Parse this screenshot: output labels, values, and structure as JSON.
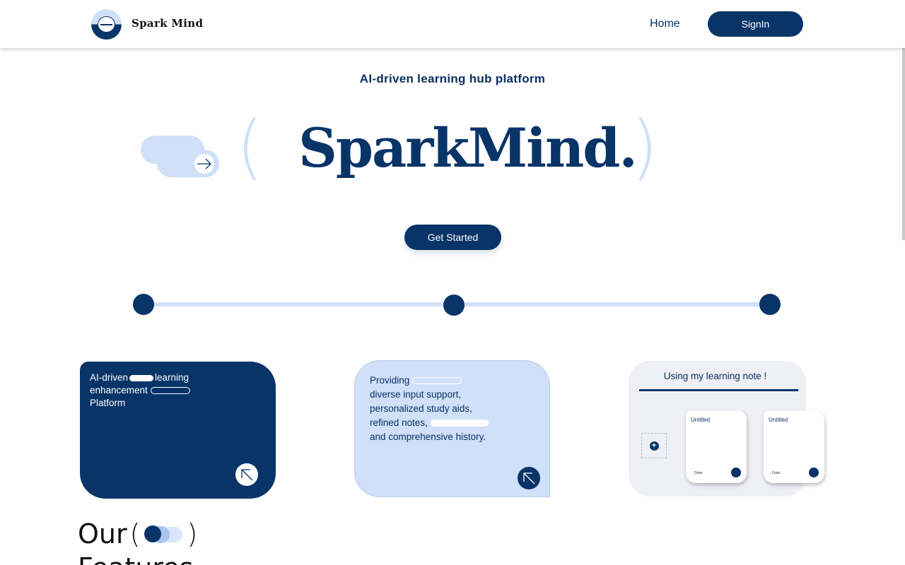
{
  "header": {
    "brand": "Spark Mind",
    "nav_home": "Home",
    "signin_label": "SignIn"
  },
  "hero": {
    "subtitle": "AI-driven learning hub platform",
    "title": "SparkMind.",
    "paren_left": "(",
    "paren_right": ")",
    "cta_label": "Get Started"
  },
  "cards": {
    "card1": {
      "line1a": "AI-driven",
      "line1b": "learning",
      "line2": "enhancement",
      "line3": "Platform"
    },
    "card2": {
      "line1": "Providing",
      "line2": "diverse input support,",
      "line3": "personalized study aids,",
      "line4": "refined notes,",
      "line5": "and comprehensive history."
    },
    "card3": {
      "title": "Using my learning note !",
      "add_symbol": "+",
      "notes": [
        {
          "title": "Untitled",
          "date": "Date"
        },
        {
          "title": "Untitled",
          "date": "Date"
        }
      ]
    }
  },
  "features": {
    "word1": "Our",
    "paren_left": "(",
    "paren_right": ")",
    "word2": "Features"
  },
  "colors": {
    "primary": "#083468",
    "light": "#cfe0f8",
    "card_gray": "#eef0f5"
  },
  "icons": [
    "logo-icon",
    "arrow-right-icon",
    "arrow-up-left-icon",
    "plus-icon"
  ]
}
